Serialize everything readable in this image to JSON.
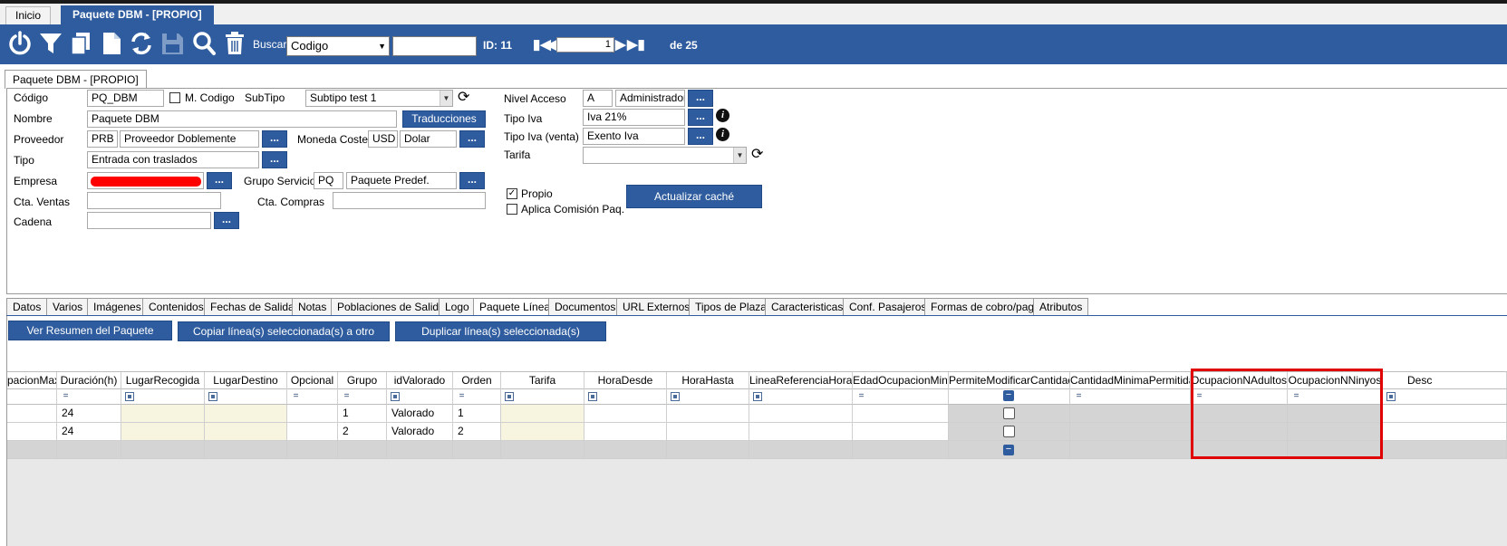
{
  "doc_tabs": [
    {
      "label": "Inicio",
      "active": false
    },
    {
      "label": "Paquete DBM - [PROPIO]",
      "active": true
    }
  ],
  "toolbar": {
    "icons": [
      "power-icon",
      "filter-icon",
      "copy-icon",
      "new-document-icon",
      "refresh-icon",
      "save-icon",
      "search-icon",
      "delete-icon"
    ],
    "buscar_label": "Buscar",
    "buscar_field": "Codigo",
    "buscar_value": "",
    "id_label": "ID: 11",
    "record_number": "1",
    "record_total": "de 25"
  },
  "form_tab": "Paquete DBM - [PROPIO]",
  "form": {
    "codigo_label": "Código",
    "codigo_value": "PQ_DBM",
    "m_codigo_label": "M. Codigo",
    "m_codigo_checked": false,
    "subtipo_label": "SubTipo",
    "subtipo_value": "Subtipo test 1",
    "nombre_label": "Nombre",
    "nombre_value": "Paquete DBM",
    "traducciones_label": "Traducciones",
    "proveedor_label": "Proveedor",
    "proveedor_code": "PRB",
    "proveedor_name": "Proveedor Doblemente",
    "moneda_label": "Moneda Coste",
    "moneda_code": "USD",
    "moneda_name": "Dolar",
    "tipo_label": "Tipo",
    "tipo_value": "Entrada con traslados",
    "empresa_label": "Empresa",
    "grupo_servicio_label": "Grupo Servicio",
    "grupo_servicio_code": "PQ",
    "grupo_servicio_name": "Paquete Predef.",
    "cta_ventas_label": "Cta. Ventas",
    "cta_ventas_value": "",
    "cta_compras_label": "Cta. Compras",
    "cta_compras_value": "",
    "cadena_label": "Cadena",
    "cadena_value": "",
    "nivel_acceso_label": "Nivel Acceso",
    "nivel_acceso_code": "A",
    "nivel_acceso_name": "Administrador",
    "tipo_iva_label": "Tipo Iva",
    "tipo_iva_value": "Iva 21%",
    "tipo_iva_venta_label": "Tipo Iva (venta)",
    "tipo_iva_venta_value": "Exento Iva",
    "tarifa_label": "Tarifa",
    "tarifa_value": "",
    "propio_label": "Propio",
    "propio_checked": true,
    "aplica_comision_label": "Aplica Comisión Paq.",
    "aplica_comision_checked": false,
    "actualizar_cache_label": "Actualizar caché",
    "dots_label": "...",
    "info_glyph": "i"
  },
  "sub_tabs": [
    {
      "label": "Datos",
      "active": false
    },
    {
      "label": "Varios",
      "active": false
    },
    {
      "label": "Imágenes",
      "active": false
    },
    {
      "label": "Contenidos",
      "active": false
    },
    {
      "label": "Fechas de Salida",
      "active": false
    },
    {
      "label": "Notas",
      "active": false
    },
    {
      "label": "Poblaciones de Salida",
      "active": false
    },
    {
      "label": "Logo",
      "active": false
    },
    {
      "label": "Paquete Línea",
      "active": true
    },
    {
      "label": "Documentos",
      "active": false
    },
    {
      "label": "URL Externos",
      "active": false
    },
    {
      "label": "Tipos de Plaza",
      "active": false
    },
    {
      "label": "Caracteristicas",
      "active": false
    },
    {
      "label": "Conf. Pasajeros",
      "active": false
    },
    {
      "label": "Formas de cobro/pago",
      "active": false
    },
    {
      "label": "Atributos",
      "active": false
    }
  ],
  "actions": {
    "ver_resumen": "Ver Resumen del Paquete",
    "copiar_lineas": "Copiar línea(s) seleccionada(s) a otro paquete",
    "duplicar_lineas": "Duplicar línea(s) seleccionada(s)"
  },
  "grid": {
    "columns": [
      "pacionMax",
      "Duración(h)",
      "LugarRecogida",
      "LugarDestino",
      "Opcional",
      "Grupo",
      "idValorado",
      "Orden",
      "Tarifa",
      "HoraDesde",
      "HoraHasta",
      "LineaReferenciaHora",
      "EdadOcupacionMin",
      "PermiteModificarCantidad",
      "CantidadMinimaPermitida",
      "OcupacionNAdultos",
      "OcupacionNNinyos",
      "Desc"
    ],
    "rows": [
      [
        "",
        "24",
        "",
        "",
        "",
        "1",
        "Valorado",
        "1",
        "",
        "",
        "",
        "",
        "",
        "",
        "",
        "",
        "",
        ""
      ],
      [
        "",
        "24",
        "",
        "",
        "",
        "2",
        "Valorado",
        "2",
        "",
        "",
        "",
        "",
        "",
        "",
        "",
        "",
        "",
        ""
      ]
    ],
    "filter_eq": "="
  },
  "colors": {
    "brand": "#2e5c9e",
    "highlight": "#e00000",
    "cream_cell": "#f7f4e0",
    "gray_cell": "#d4d4d4"
  }
}
